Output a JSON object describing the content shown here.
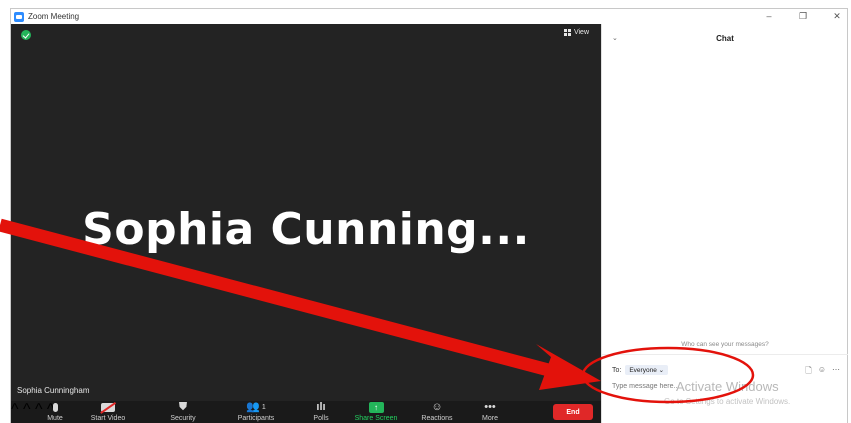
{
  "window": {
    "title": "Zoom Meeting",
    "controls": [
      "–",
      "❐",
      "✕"
    ]
  },
  "video": {
    "participant_display": "Sophia Cunning...",
    "name_tag": "Sophia Cunningham",
    "view_label": "View"
  },
  "toolbar": {
    "mute": "Mute",
    "start_video": "Start Video",
    "security": "Security",
    "participants": "Participants",
    "participants_count": "1",
    "polls": "Polls",
    "share_screen": "Share Screen",
    "reactions": "Reactions",
    "more": "More",
    "end": "End"
  },
  "chat": {
    "title": "Chat",
    "who_can_see": "Who can see your messages?",
    "to_label": "To:",
    "to_value": "Everyone",
    "input_placeholder": "Type message here...",
    "watermark_title": "Activate Windows",
    "watermark_sub": "Go to Settings to activate Windows."
  },
  "colors": {
    "video_bg": "#232323",
    "toolbar_bg": "#1a1a1a",
    "end_red": "#e02828",
    "share_green": "#23b55a",
    "annotation_red": "#e3120b"
  }
}
